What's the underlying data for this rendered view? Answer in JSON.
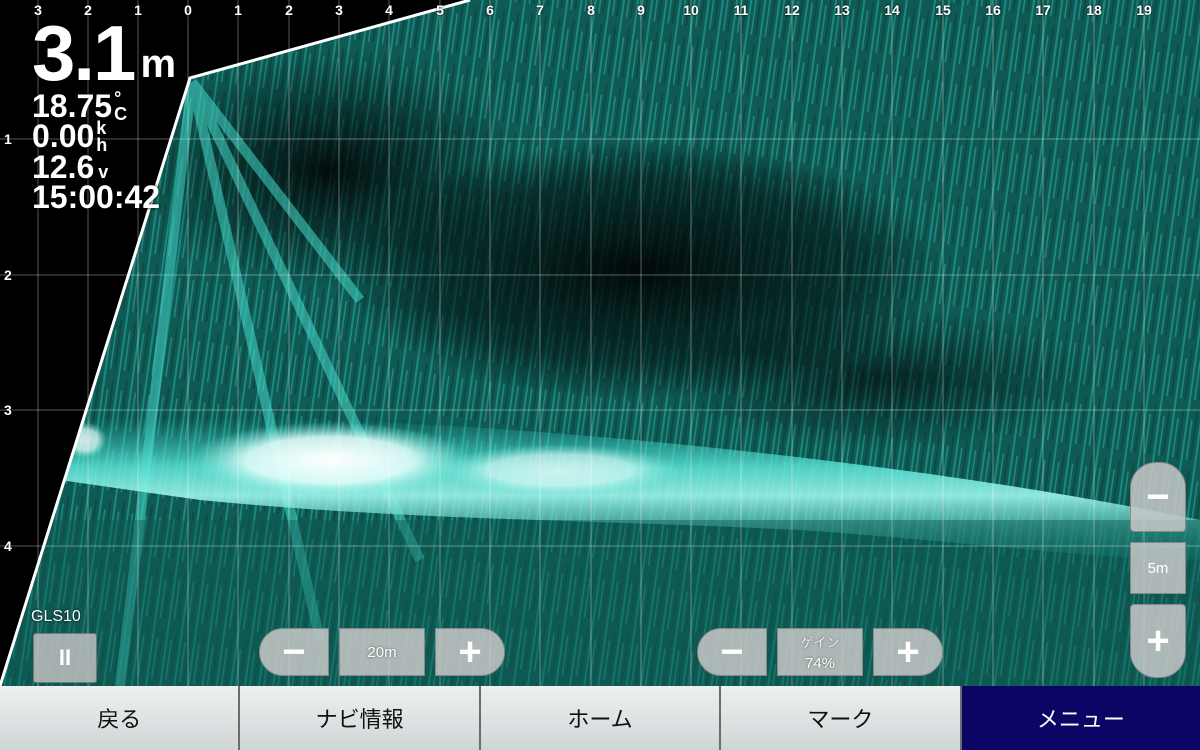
{
  "readouts": {
    "depth_value": "3.1",
    "depth_unit": "m",
    "temperature_value": "18.75",
    "temperature_unit_top": "°",
    "temperature_unit_bottom": "C",
    "speed_value": "0.00",
    "speed_unit_top": "k",
    "speed_unit_bottom": "h",
    "voltage_value": "12.6",
    "voltage_unit": "v",
    "time": "15:00:42"
  },
  "x_axis_labels": [
    "3",
    "2",
    "1",
    "0",
    "1",
    "2",
    "3",
    "4",
    "5",
    "6",
    "7",
    "8",
    "9",
    "10",
    "11",
    "12",
    "13",
    "14",
    "15",
    "16",
    "17",
    "18",
    "19"
  ],
  "y_axis_labels": [
    "1",
    "2",
    "3",
    "4"
  ],
  "transducer_label": "GLS10",
  "pause_button_label": "II",
  "range_control": {
    "minus_label": "−",
    "value": "20m",
    "plus_label": "+"
  },
  "gain_control": {
    "minus_label": "−",
    "label": "ゲイン",
    "value": "74%",
    "plus_label": "+"
  },
  "vertical_range_control": {
    "minus_label": "−",
    "value": "5m",
    "plus_label": "+"
  },
  "bottom_nav": {
    "back": "戻る",
    "nav_info": "ナビ情報",
    "home": "ホーム",
    "mark": "マーク",
    "menu": "メニュー"
  },
  "colors": {
    "sonar_teal": "#1aa79c",
    "sonar_dark": "#0a2624",
    "bottom_echo": "#ffffff",
    "menu_active": "#0b0565"
  }
}
